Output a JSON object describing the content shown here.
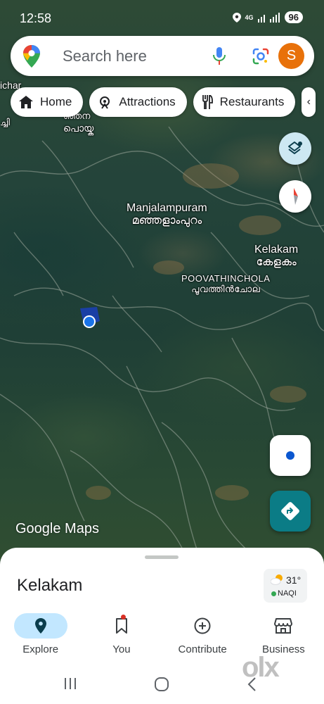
{
  "status": {
    "time": "12:58",
    "network": "4G",
    "battery": "96"
  },
  "search": {
    "placeholder": "Search here",
    "avatar_letter": "S"
  },
  "chips": [
    {
      "label": "Home",
      "icon": "home-icon"
    },
    {
      "label": "Attractions",
      "icon": "attractions-icon"
    },
    {
      "label": "Restaurants",
      "icon": "restaurant-icon"
    }
  ],
  "map_labels": {
    "edge_top_left_1": "ichar",
    "edge_top_left_2": "ച്ചി",
    "near_top_ml_1": "ഞ്ഞന",
    "near_top_ml_2": "പൊയ്ക",
    "manjalampuram_en": "Manjalampuram",
    "manjalampuram_ml": "മഞ്ഞളാംപുറം",
    "kelakam_en": "Kelakam",
    "kelakam_ml": "കേളകം",
    "poovathinchola_en": "POOVATHINCHOLA",
    "poovathinchola_ml": "പൂവത്തിൻചോല"
  },
  "attribution": "Google Maps",
  "sheet": {
    "place_title": "Kelakam",
    "weather": {
      "temp": "31°",
      "aqi": "NAQI"
    }
  },
  "nav": [
    {
      "label": "Explore",
      "icon": "explore-pin-icon",
      "active": true
    },
    {
      "label": "You",
      "icon": "bookmark-icon",
      "active": false
    },
    {
      "label": "Contribute",
      "icon": "add-circle-icon",
      "active": false
    },
    {
      "label": "Business",
      "icon": "storefront-icon",
      "active": false
    }
  ],
  "watermark": "olx",
  "colors": {
    "accent": "#0b57d0",
    "directions": "#0b7c86",
    "avatar": "#e8710a"
  }
}
